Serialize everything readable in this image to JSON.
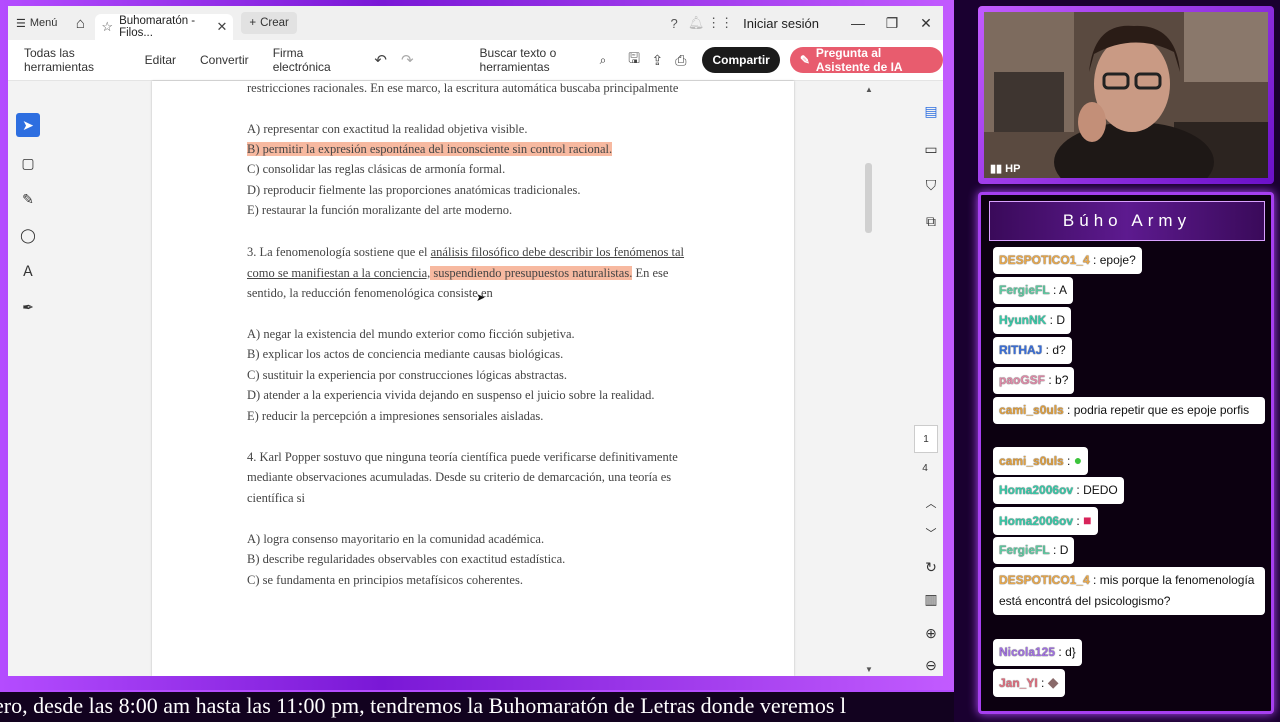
{
  "titlebar": {
    "menu_label": "Menú",
    "tab_title": "Buhomaratón - Filos...",
    "new_tab_label": "Crear",
    "signin_label": "Iniciar sesión"
  },
  "toolbar": {
    "items": [
      "Todas las herramientas",
      "Editar",
      "Convertir",
      "Firma electrónica"
    ],
    "search_label": "Buscar texto o herramientas",
    "share_label": "Compartir",
    "ai_label": "Pregunta al Asistente de IA"
  },
  "document": {
    "lines": [
      {
        "text": "restricciones racionales. En ese marco, la escritura automática buscaba principalmente",
        "style": "plain"
      },
      {
        "text": "A) representar con exactitud la realidad objetiva visible.",
        "style": "plain"
      },
      {
        "text": "B) permitir la expresión espontánea del inconsciente sin control racional.",
        "style": "highlight"
      },
      {
        "text": "C) consolidar las reglas clásicas de armonía formal.",
        "style": "plain"
      },
      {
        "text": "D) reproducir fielmente las proporciones anatómicas tradicionales.",
        "style": "plain"
      },
      {
        "text": "E) restaurar la función moralizante del arte moderno.",
        "style": "plain"
      },
      {
        "text": "3. La fenomenología sostiene que el análisis filosófico debe describir los fenómenos tal",
        "style": "plain"
      },
      {
        "text": "como se manifiestan a la conciencia, suspendiendo presupuestos naturalistas. En ese",
        "style": "plain"
      },
      {
        "text": "sentido, la reducción fenomenológica consiste en",
        "style": "plain"
      },
      {
        "text": "A) negar la existencia del mundo exterior como ficción subjetiva.",
        "style": "plain"
      },
      {
        "text": "B) explicar los actos de conciencia mediante causas biológicas.",
        "style": "plain"
      },
      {
        "text": "C) sustituir la experiencia por construcciones lógicas abstractas.",
        "style": "plain"
      },
      {
        "text": "D) atender a la experiencia vivida dejando en suspenso el juicio sobre la realidad.",
        "style": "plain"
      },
      {
        "text": "E) reducir la percepción a impresiones sensoriales aisladas.",
        "style": "plain"
      },
      {
        "text": "4. Karl Popper sostuvo que ninguna teoría científica puede verificarse definitivamente",
        "style": "plain"
      },
      {
        "text": "mediante observaciones acumuladas. Desde su criterio de demarcación, una teoría es",
        "style": "plain"
      },
      {
        "text": "científica si",
        "style": "plain"
      },
      {
        "text": "A) logra consenso mayoritario en la comunidad académica.",
        "style": "plain"
      },
      {
        "text": "B) describe regularidades observables con exactitud estadística.",
        "style": "plain"
      },
      {
        "text": "C) se fundamenta en principios metafísicos coherentes.",
        "style": "plain"
      }
    ],
    "q3_parts": {
      "line1_a": "3. La fenomenología sostiene que el ",
      "line1_b": "análisis filosófico debe describir los fenómenos tal",
      "line2_a": "como se manifiestan a la conciencia,",
      "line2_b": " suspendiendo presupuestos naturalistas.",
      "line2_c": " En ese"
    },
    "current_page": "1",
    "total_pages": "4"
  },
  "webcam": {
    "badge": "HP"
  },
  "chat": {
    "title": "Búho Army",
    "messages": [
      {
        "user": "DESPOTICO1_4",
        "text": "epoje?",
        "color": "#e8a84c"
      },
      {
        "user": "FergieFL",
        "text": "A",
        "color": "#5ec8a0"
      },
      {
        "user": "HyunNK",
        "text": "D",
        "color": "#38c9a8"
      },
      {
        "user": "RITHAJ",
        "text": "d?",
        "color": "#3a6fd8"
      },
      {
        "user": "paoGSF",
        "text": "b?",
        "color": "#e08aa8"
      },
      {
        "user": "cami_s0uls",
        "text": "podria repetir que es epoje porfis",
        "color": "#e0a040"
      },
      {
        "user": "cami_s0uls",
        "text": "",
        "color": "#e0a040"
      },
      {
        "user": "Homa2006ov",
        "text": "DEDO",
        "color": "#38c9a8"
      },
      {
        "user": "Homa2006ov",
        "text": "",
        "color": "#38c9a8"
      },
      {
        "user": "FergieFL",
        "text": "D",
        "color": "#5ec8a0"
      },
      {
        "user": "DESPOTICO1_4",
        "text": "mis porque la fenomenología está encontrá del psicologismo?",
        "color": "#e8a84c"
      },
      {
        "user": "Nicola125",
        "text": "d}",
        "color": "#a070e0"
      },
      {
        "user": "Jan_YI",
        "text": "",
        "color": "#e07080"
      }
    ]
  },
  "ticker": {
    "text": "ero, desde las 8:00 am hasta las 11:00 pm, tendremos la Buhomaratón de Letras donde veremos l"
  },
  "colors": {
    "frame_accent": "#b44cff",
    "highlight": "#f7b9a0",
    "share_button": "#1b1b1b",
    "ai_button": "#e85c6e",
    "active_tool": "#2d6ee0"
  }
}
